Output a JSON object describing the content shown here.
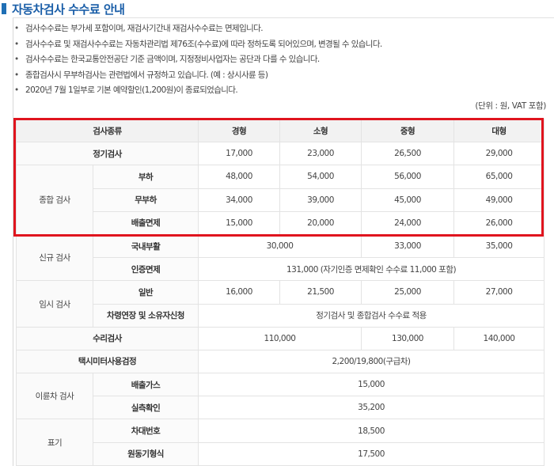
{
  "header": {
    "title": "자동차검사 수수료 안내"
  },
  "notes": [
    "검사수수료는 부가세 포함이며, 재검사기간내 재검사수수료는 면제입니다.",
    "검사수수료 및 재검사수수료는 자동차관리법 제76조(수수료)에 따라 정하도록 되어있으며, 변경될 수 있습니다.",
    "검사수수료는 한국교통안전공단 기준 금액이며, 지정정비사업자는 공단과 다를 수 있습니다.",
    "종합검사시 무부하검사는 관련법에서 규정하고 있습니다. (예 : 상시사륜 등)",
    "2020년 7월 1일부로 기본 예약할인(1,200원)이 종료되었습니다."
  ],
  "unit": "(단위 : 원, VAT 포함)",
  "table": {
    "headers": [
      "검사종류",
      "경형",
      "소형",
      "중형",
      "대형"
    ],
    "regular": {
      "label": "정기검사",
      "values": [
        "17,000",
        "23,000",
        "26,500",
        "29,000"
      ]
    },
    "comprehensive": {
      "label": "종합 검사",
      "rows": [
        {
          "label": "부하",
          "values": [
            "48,000",
            "54,000",
            "56,000",
            "65,000"
          ]
        },
        {
          "label": "무부하",
          "values": [
            "34,000",
            "39,000",
            "45,000",
            "49,000"
          ]
        },
        {
          "label": "배출면제",
          "values": [
            "15,000",
            "20,000",
            "24,000",
            "26,000"
          ]
        }
      ]
    },
    "new_reg": {
      "label": "신규 검사",
      "domestic": {
        "label": "국내부활",
        "small_mid": "30,000",
        "mid": "33,000",
        "large": "35,000"
      },
      "cert": {
        "label": "인증면제",
        "value": "131,000 (자기인증 면제확인 수수료 11,000 포함)"
      }
    },
    "temp": {
      "label": "임시 검사",
      "general": {
        "label": "일반",
        "values": [
          "16,000",
          "21,500",
          "25,000",
          "27,000"
        ]
      },
      "extension": {
        "label": "차령연장 및 소유자신청",
        "value": "정기검사 및 종합검사 수수료 적용"
      }
    },
    "repair": {
      "label": "수리검사",
      "small_mid": "110,000",
      "mid": "130,000",
      "large": "140,000"
    },
    "taxi": {
      "label": "택시미터사용검정",
      "value": "2,200/19,800(구급차)"
    },
    "two_wheel": {
      "label": "이륜차 검사",
      "emission": {
        "label": "배출가스",
        "value": "15,000"
      },
      "noise": {
        "label": "실측확인",
        "value": "35,200"
      }
    },
    "marking": {
      "label": "표기",
      "chassis": {
        "label": "차대번호",
        "value": "18,500"
      },
      "engine": {
        "label": "원동기형식",
        "value": "17,500"
      }
    }
  }
}
